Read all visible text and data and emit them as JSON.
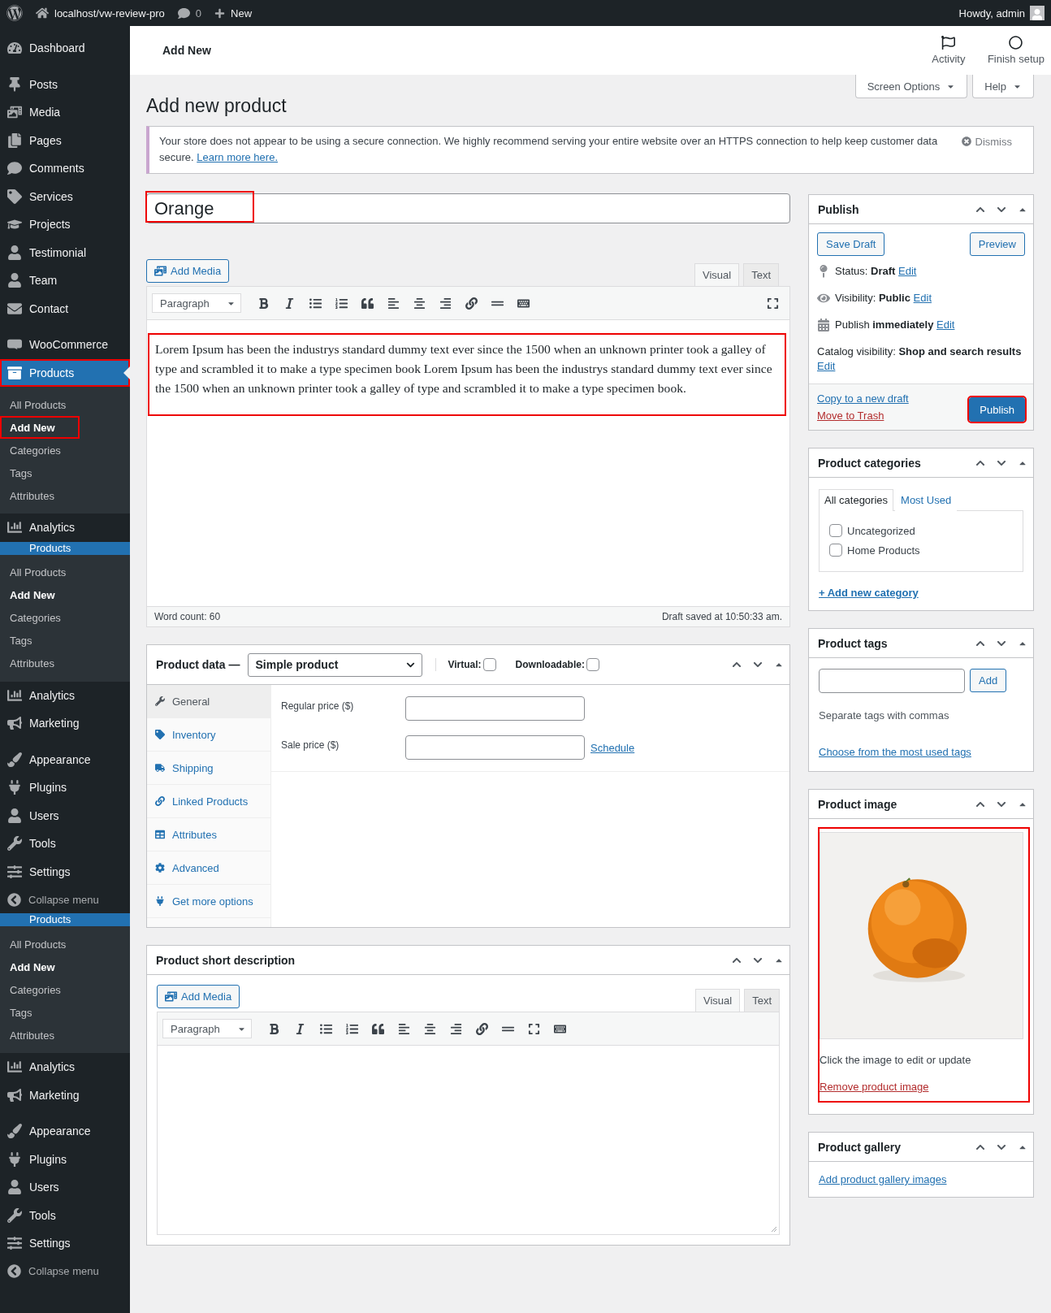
{
  "admin_bar": {
    "site": "localhost/vw-review-pro",
    "comments": "0",
    "new": "New",
    "greeting": "Howdy, admin"
  },
  "sidebar": {
    "items": [
      {
        "kind": "menu",
        "label": "Dashboard",
        "selected": false,
        "highlighted": false
      },
      {
        "kind": "separator"
      },
      {
        "kind": "menu",
        "label": "Posts",
        "selected": false,
        "highlighted": false
      },
      {
        "kind": "menu",
        "label": "Media",
        "selected": false,
        "highlighted": false
      },
      {
        "kind": "menu",
        "label": "Pages",
        "selected": false,
        "highlighted": false
      },
      {
        "kind": "menu",
        "label": "Comments",
        "selected": false,
        "highlighted": false
      },
      {
        "kind": "menu",
        "label": "Services",
        "selected": false,
        "highlighted": false
      },
      {
        "kind": "menu",
        "label": "Projects",
        "selected": false,
        "highlighted": false
      },
      {
        "kind": "menu",
        "label": "Testimonial",
        "selected": false,
        "highlighted": false
      },
      {
        "kind": "menu",
        "label": "Team",
        "selected": false,
        "highlighted": false
      },
      {
        "kind": "menu",
        "label": "Contact",
        "selected": false,
        "highlighted": false
      },
      {
        "kind": "separator"
      },
      {
        "kind": "menu",
        "label": "WooCommerce",
        "selected": false,
        "highlighted": false
      },
      {
        "kind": "menu",
        "label": "Products",
        "selected": true,
        "highlighted": true,
        "children": [
          {
            "label": "All Products",
            "selected": false,
            "highlighted": false
          },
          {
            "label": "Add New",
            "selected": true,
            "highlighted": true
          },
          {
            "label": "Categories",
            "selected": false,
            "highlighted": false
          },
          {
            "label": "Tags",
            "selected": false,
            "highlighted": false
          },
          {
            "label": "Attributes",
            "selected": false,
            "highlighted": false
          }
        ]
      },
      {
        "kind": "menu",
        "label": "Analytics",
        "selected": false,
        "highlighted": false
      },
      {
        "kind": "cut",
        "label": "Products",
        "children": [
          {
            "label": "All Products",
            "selected": false,
            "highlighted": false
          },
          {
            "label": "Add New",
            "selected": true,
            "highlighted": false
          },
          {
            "label": "Categories",
            "selected": false,
            "highlighted": false
          },
          {
            "label": "Tags",
            "selected": false,
            "highlighted": false
          },
          {
            "label": "Attributes",
            "selected": false,
            "highlighted": false
          }
        ]
      },
      {
        "kind": "menu",
        "label": "Analytics",
        "selected": false,
        "highlighted": false
      },
      {
        "kind": "menu",
        "label": "Marketing",
        "selected": false,
        "highlighted": false
      },
      {
        "kind": "separator"
      },
      {
        "kind": "menu",
        "label": "Appearance",
        "selected": false,
        "highlighted": false
      },
      {
        "kind": "menu",
        "label": "Plugins",
        "selected": false,
        "highlighted": false
      },
      {
        "kind": "menu",
        "label": "Users",
        "selected": false,
        "highlighted": false
      },
      {
        "kind": "menu",
        "label": "Tools",
        "selected": false,
        "highlighted": false
      },
      {
        "kind": "menu",
        "label": "Settings",
        "selected": false,
        "highlighted": false
      },
      {
        "kind": "collapse",
        "label": "Collapse menu"
      },
      {
        "kind": "cut",
        "label": "Products",
        "children": [
          {
            "label": "All Products",
            "selected": false,
            "highlighted": false
          },
          {
            "label": "Add New",
            "selected": true,
            "highlighted": false
          },
          {
            "label": "Categories",
            "selected": false,
            "highlighted": false
          },
          {
            "label": "Tags",
            "selected": false,
            "highlighted": false
          },
          {
            "label": "Attributes",
            "selected": false,
            "highlighted": false
          }
        ]
      },
      {
        "kind": "menu",
        "label": "Analytics",
        "selected": false,
        "highlighted": false
      },
      {
        "kind": "menu",
        "label": "Marketing",
        "selected": false,
        "highlighted": false
      },
      {
        "kind": "separator"
      },
      {
        "kind": "menu",
        "label": "Appearance",
        "selected": false,
        "highlighted": false
      },
      {
        "kind": "menu",
        "label": "Plugins",
        "selected": false,
        "highlighted": false
      },
      {
        "kind": "menu",
        "label": "Users",
        "selected": false,
        "highlighted": false
      },
      {
        "kind": "menu",
        "label": "Tools",
        "selected": false,
        "highlighted": false
      },
      {
        "kind": "menu",
        "label": "Settings",
        "selected": false,
        "highlighted": false
      },
      {
        "kind": "collapse",
        "label": "Collapse menu"
      }
    ]
  },
  "header": {
    "title": "Add New",
    "actions": [
      "Activity",
      "Finish setup"
    ]
  },
  "screen_tabs": [
    "Screen Options",
    "Help"
  ],
  "page_title": "Add new product",
  "notice": {
    "text": "Your store does not appear to be using a secure connection. We highly recommend serving your entire website over an HTTPS connection to help keep customer data secure.",
    "link": "Learn more here.",
    "dismiss": "Dismiss"
  },
  "title_field": {
    "value": "Orange",
    "highlighted": true
  },
  "editor": {
    "add_media": "Add Media",
    "tabs": [
      {
        "label": "Visual",
        "selected": true
      },
      {
        "label": "Text",
        "selected": false
      }
    ],
    "format": "Paragraph",
    "content": "Lorem Ipsum has been the industrys standard dummy text ever since the 1500 when an unknown printer took a galley of type and scrambled it to make a type specimen book Lorem Ipsum has been the industrys standard dummy text ever since the 1500 when an unknown printer took a galley of type and scrambled it to make a type specimen book.",
    "highlighted": true,
    "word_count": "Word count: 60",
    "saved": "Draft saved at 10:50:33 am."
  },
  "product_data": {
    "title": "Product data —",
    "type": "Simple product",
    "options": [
      {
        "label": "Virtual:",
        "checked": false
      },
      {
        "label": "Downloadable:",
        "checked": false
      }
    ],
    "tabs": [
      {
        "label": "General",
        "selected": true
      },
      {
        "label": "Inventory",
        "selected": false
      },
      {
        "label": "Shipping",
        "selected": false
      },
      {
        "label": "Linked Products",
        "selected": false
      },
      {
        "label": "Attributes",
        "selected": false
      },
      {
        "label": "Advanced",
        "selected": false
      },
      {
        "label": "Get more options",
        "selected": false
      }
    ],
    "fields": [
      {
        "label": "Regular price ($)"
      },
      {
        "label": "Sale price ($)",
        "link": "Schedule"
      }
    ]
  },
  "short_description": {
    "title": "Product short description",
    "add_media": "Add Media",
    "tabs": [
      {
        "label": "Visual",
        "selected": true
      },
      {
        "label": "Text",
        "selected": false
      }
    ],
    "format": "Paragraph"
  },
  "publish": {
    "title": "Publish",
    "save_draft": "Save Draft",
    "preview": "Preview",
    "rows": [
      {
        "text": "Status: **Draft**",
        "link": "Edit"
      },
      {
        "text": "Visibility: **Public**",
        "link": "Edit"
      },
      {
        "text": "Publish **immediately**",
        "link": "Edit"
      },
      {
        "text": "Catalog visibility: **Shop and search results**",
        "link": "Edit"
      }
    ],
    "copy": "Copy to a new draft",
    "trash": "Move to Trash",
    "button": "Publish",
    "highlighted": true
  },
  "categories": {
    "title": "Product categories",
    "tabs": [
      {
        "label": "All categories",
        "selected": true
      },
      {
        "label": "Most Used",
        "selected": false
      }
    ],
    "items": [
      {
        "label": "Uncategorized",
        "checked": false
      },
      {
        "label": "Home Products",
        "checked": false
      }
    ],
    "add_link": "+ Add new category"
  },
  "tags": {
    "title": "Product tags",
    "button": "Add",
    "hint": "Separate tags with commas",
    "link": "Choose from the most used tags"
  },
  "image": {
    "title": "Product image",
    "caption": "Click the image to edit or update",
    "remove": "Remove product image",
    "highlighted": true
  },
  "gallery": {
    "title": "Product gallery",
    "link": "Add product gallery images"
  }
}
